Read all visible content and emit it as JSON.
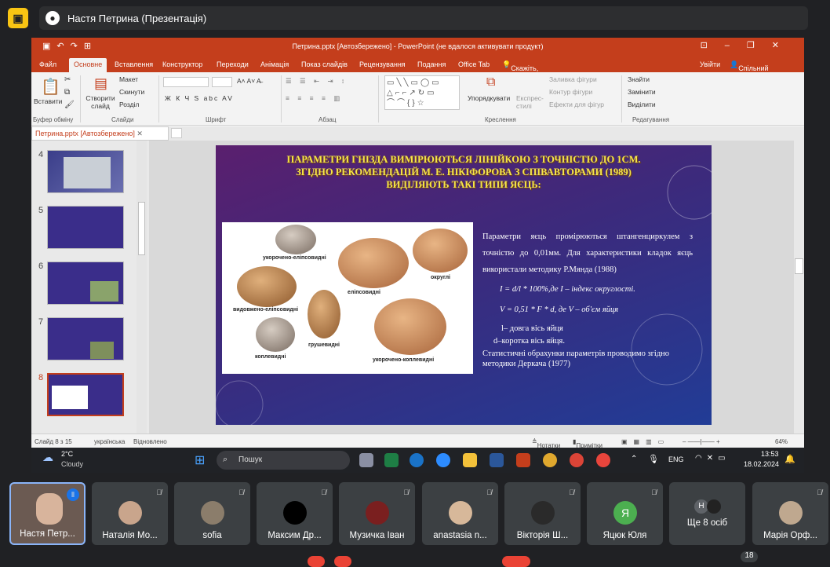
{
  "meet": {
    "presenter_title": "Настя Петрина (Презентація)",
    "badge_count": "18"
  },
  "ppt": {
    "window_title": "Петрина.pptx [Автозбережено] - PowerPoint (не вдалося активувати продукт)",
    "menu": [
      "Файл",
      "Основне",
      "Вставлення",
      "Конструктор",
      "Переходи",
      "Анімація",
      "Показ слайдів",
      "Рецензування",
      "Подання",
      "Office Tab"
    ],
    "tell_me": "Скажіть, що потрібно зробити...",
    "login": "Увійти",
    "share": "Спільний доступ",
    "ribbon": {
      "paste": "Вставити",
      "clipboard": "Буфер обміну",
      "new_slide": "Створити слайд",
      "layout": "Макет",
      "reset": "Скинути",
      "section": "Розділ",
      "slides": "Слайди",
      "font": "Шрифт",
      "paragraph": "Абзац",
      "arrange": "Упорядкувати",
      "quick_styles": "Експрес-стилі",
      "fill": "Заливка фігури",
      "outline": "Контур фігури",
      "effects": "Ефекти для фігур",
      "drawing": "Креслення",
      "find": "Знайти",
      "replace": "Замінити",
      "select": "Виділити",
      "editing": "Редагування",
      "font_buttons": "Ж К Ч S abc AV"
    },
    "doc_tab": "Петрина.pptx [Автозбережено]",
    "thumb_numbers": [
      "4",
      "5",
      "6",
      "7",
      "8"
    ],
    "status": {
      "slide_of": "Слайд 8 з 15",
      "language": "українська",
      "restored": "Відновлено",
      "notes": "Нотатки",
      "comments": "Примітки",
      "zoom": "64%"
    }
  },
  "slide": {
    "title_lines": [
      "ПАРАМЕТРИ ГНІЗДА ВИМІРЮЮТЬСЯ ЛІНІЙКОЮ З ТОЧНІСТЮ ДО 1СМ.",
      "ЗГІДНО РЕКОМЕНДАЦІЙ М. Е. НІКІФОРОВА З СПІВАВТОРАМИ (1989)",
      "ВИДІЛЯЮТЬ ТАКІ ТИПИ ЯЄЦЬ:"
    ],
    "egg_labels": [
      "укорочено-еліпсовидні",
      "округлі",
      "еліпсовидні",
      "видовжено-еліпсовидні",
      "грушевидні",
      "коплевидні",
      "укорочено-коплевидні"
    ],
    "paragraph": "Параметри яєць промірюються штангенциркулем з точністю до 0,01мм. Для характеристики кладок яєць використали методику Р.Мянда (1988)",
    "formula1": "I = d/l * 100%,де  I – індекс округлості.",
    "formula2": "V = 0,51 * F * d, де V – об'єм яйця",
    "def_l": "l– довга вісь яйця",
    "def_d": "d–коротка вісь яйця.",
    "stats": "Статистичні обрахунки параметрів проводимо згідно методики Деркача (1977)"
  },
  "taskbar": {
    "temp": "2°C",
    "weather": "Cloudy",
    "search": "Пошук",
    "lang": "ENG",
    "time": "13:53",
    "date": "18.02.2024"
  },
  "participants": [
    {
      "name": "Настя Петр...",
      "avatar": "photo"
    },
    {
      "name": "Наталія Мо...",
      "avatar": "photo"
    },
    {
      "name": "sofia",
      "avatar": "photo"
    },
    {
      "name": "Максим Др...",
      "avatar": "black"
    },
    {
      "name": "Музичка Іван",
      "avatar": "photo"
    },
    {
      "name": "anastasia n...",
      "avatar": "photo"
    },
    {
      "name": "Вікторія Ш...",
      "avatar": "photo"
    },
    {
      "name": "Яцюк Юля",
      "avatar": "Я"
    },
    {
      "name": "Ще 8 осіб",
      "avatar": "Н"
    },
    {
      "name": "Марія Орф...",
      "avatar": "photo"
    }
  ],
  "colors": {
    "ppt_accent": "#c43e1c",
    "meet_bg": "#202124",
    "slide_title": "#f6e64a",
    "avatar_green": "#4caf50"
  }
}
